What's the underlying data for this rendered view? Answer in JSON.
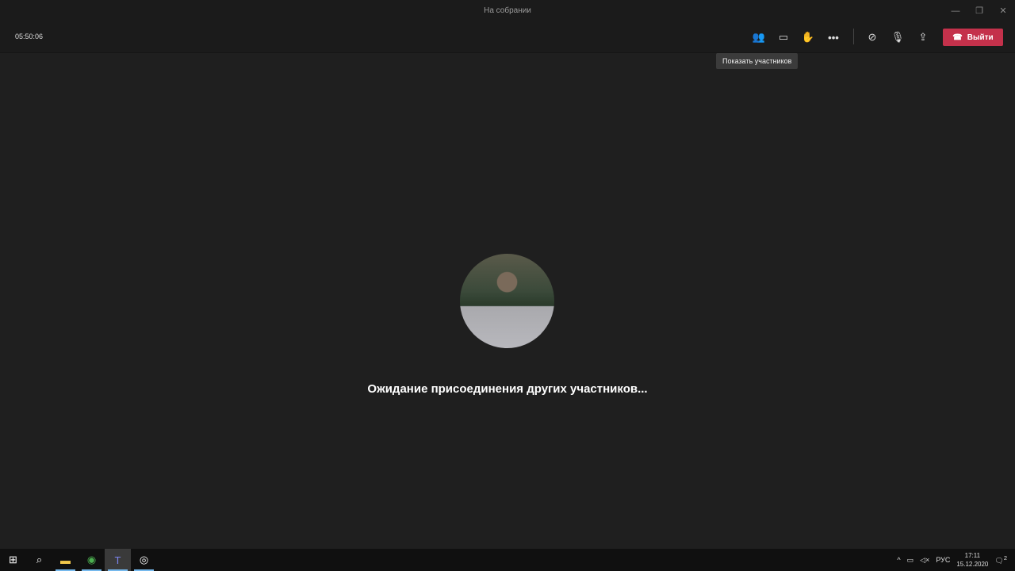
{
  "window": {
    "title": "На собрании"
  },
  "toolbar": {
    "timer": "05:50:06",
    "leave_label": "Выйти",
    "tooltip": "Показать участников"
  },
  "main": {
    "waiting_text": "Ожидание присоединения других участников..."
  },
  "taskbar": {
    "lang": "РУС",
    "time": "17:11",
    "date": "15.12.2020",
    "notifications": "2"
  },
  "colors": {
    "leave": "#c4314b",
    "bg": "#1f1f1f"
  }
}
